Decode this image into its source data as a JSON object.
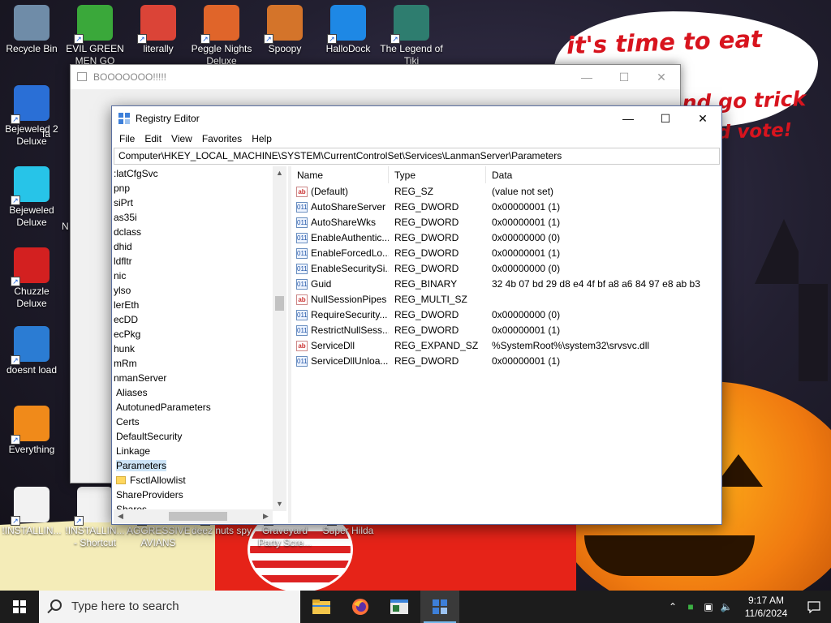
{
  "desktop": {
    "icons": [
      {
        "label": "Recycle Bin",
        "color": "#6f8ca8"
      },
      {
        "label": "EVIL GREEN MEN GO",
        "color": "#3aa83a"
      },
      {
        "label": "literally",
        "color": "#db4437"
      },
      {
        "label": "Peggle Nights Deluxe",
        "color": "#e0652a"
      },
      {
        "label": "Spoopy",
        "color": "#d4742a"
      },
      {
        "label": "HalloDock",
        "color": "#1e88e5"
      },
      {
        "label": "The Legend of Tiki",
        "color": "#2e7d6f"
      },
      {
        "label": "Bejeweled 2 Deluxe",
        "color": "#2a6fd6"
      },
      {
        "label": "Bejeweled Deluxe",
        "color": "#27c4e8"
      },
      {
        "label": "Chuzzle Deluxe",
        "color": "#d32020"
      },
      {
        "label": "doesnt load",
        "color": "#2b7cd3"
      },
      {
        "label": "Everything",
        "color": "#f08a1a"
      },
      {
        "label": "!INSTALLIN...",
        "color": "#f2f2f2"
      },
      {
        "label": "!INSTALLIN... - Shortcut",
        "color": "#f2f2f2"
      },
      {
        "label": "AGGRESSIVE AVIANS",
        "color": "#c64b2c"
      },
      {
        "label": "deez nuts spy",
        "color": "#7a4a2a"
      },
      {
        "label": "Graveyard Party Scre...",
        "color": "#444a60"
      },
      {
        "label": "Super Hilda",
        "color": "#5a8a3a"
      }
    ],
    "partial_labels": [
      "fa",
      "N"
    ],
    "speech_bubble": {
      "line1": "it's time to eat shit",
      "line2": "nd go trick",
      "line3": "and vote!"
    }
  },
  "boo_window": {
    "title": "BOOOOOOO!!!!!"
  },
  "regedit": {
    "title": "Registry Editor",
    "menu": [
      "File",
      "Edit",
      "View",
      "Favorites",
      "Help"
    ],
    "address": "Computer\\HKEY_LOCAL_MACHINE\\SYSTEM\\CurrentControlSet\\Services\\LanmanServer\\Parameters",
    "tree": [
      {
        "label": ":latCfgSvc",
        "indent": 0
      },
      {
        "label": "pnp",
        "indent": 0
      },
      {
        "label": "siPrt",
        "indent": 0
      },
      {
        "label": "as35i",
        "indent": 0
      },
      {
        "label": "dclass",
        "indent": 0
      },
      {
        "label": "dhid",
        "indent": 0
      },
      {
        "label": "ldfltr",
        "indent": 0
      },
      {
        "label": "nic",
        "indent": 0
      },
      {
        "label": "ylso",
        "indent": 0
      },
      {
        "label": "lerEth",
        "indent": 0
      },
      {
        "label": "ecDD",
        "indent": 0
      },
      {
        "label": "ecPkg",
        "indent": 0
      },
      {
        "label": "hunk",
        "indent": 0
      },
      {
        "label": "mRm",
        "indent": 0
      },
      {
        "label": "nmanServer",
        "indent": 0
      },
      {
        "label": "Aliases",
        "indent": 1
      },
      {
        "label": "AutotunedParameters",
        "indent": 1
      },
      {
        "label": "Certs",
        "indent": 1
      },
      {
        "label": "DefaultSecurity",
        "indent": 1
      },
      {
        "label": "Linkage",
        "indent": 1
      },
      {
        "label": "Parameters",
        "indent": 1,
        "selected": true
      },
      {
        "label": "FsctlAllowlist",
        "indent": 2,
        "folder": true
      },
      {
        "label": "ShareProviders",
        "indent": 1
      },
      {
        "label": "Shares",
        "indent": 1
      }
    ],
    "columns": [
      "Name",
      "Type",
      "Data"
    ],
    "values": [
      {
        "name": "(Default)",
        "type": "REG_SZ",
        "data": "(value not set)",
        "icon": "sz"
      },
      {
        "name": "AutoShareServer",
        "type": "REG_DWORD",
        "data": "0x00000001 (1)",
        "icon": "bin"
      },
      {
        "name": "AutoShareWks",
        "type": "REG_DWORD",
        "data": "0x00000001 (1)",
        "icon": "bin"
      },
      {
        "name": "EnableAuthentic...",
        "type": "REG_DWORD",
        "data": "0x00000000 (0)",
        "icon": "bin"
      },
      {
        "name": "EnableForcedLo...",
        "type": "REG_DWORD",
        "data": "0x00000001 (1)",
        "icon": "bin"
      },
      {
        "name": "EnableSecuritySi...",
        "type": "REG_DWORD",
        "data": "0x00000000 (0)",
        "icon": "bin"
      },
      {
        "name": "Guid",
        "type": "REG_BINARY",
        "data": "32 4b 07 bd 29 d8 e4 4f bf a8 a6 84 97 e8 ab b3",
        "icon": "bin"
      },
      {
        "name": "NullSessionPipes",
        "type": "REG_MULTI_SZ",
        "data": "",
        "icon": "sz"
      },
      {
        "name": "RequireSecurity...",
        "type": "REG_DWORD",
        "data": "0x00000000 (0)",
        "icon": "bin"
      },
      {
        "name": "RestrictNullSess...",
        "type": "REG_DWORD",
        "data": "0x00000001 (1)",
        "icon": "bin"
      },
      {
        "name": "ServiceDll",
        "type": "REG_EXPAND_SZ",
        "data": "%SystemRoot%\\system32\\srvsvc.dll",
        "icon": "sz"
      },
      {
        "name": "ServiceDllUnloa...",
        "type": "REG_DWORD",
        "data": "0x00000001 (1)",
        "icon": "bin"
      }
    ]
  },
  "taskbar": {
    "search_placeholder": "Type here to search",
    "time": "9:17 AM",
    "date": "11/6/2024",
    "accent": "#76b9ed"
  }
}
